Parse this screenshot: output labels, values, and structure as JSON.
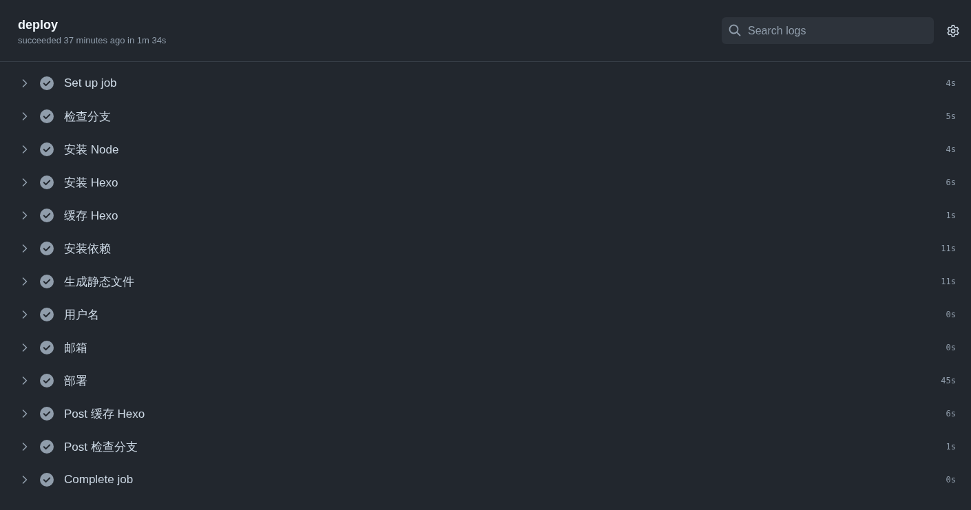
{
  "job": {
    "title": "deploy",
    "summary": "succeeded 37 minutes ago in 1m 34s"
  },
  "search": {
    "placeholder": "Search logs"
  },
  "steps": [
    {
      "name": "Set up job",
      "duration": "4s",
      "kind": "success",
      "expanded": false
    },
    {
      "name": "检查分支",
      "duration": "5s",
      "kind": "success",
      "expanded": false
    },
    {
      "name": "安装 Node",
      "duration": "4s",
      "kind": "success",
      "expanded": false
    },
    {
      "name": "安装 Hexo",
      "duration": "6s",
      "kind": "success",
      "expanded": false
    },
    {
      "name": "缓存 Hexo",
      "duration": "1s",
      "kind": "success",
      "expanded": false
    },
    {
      "name": "安装依赖",
      "duration": "11s",
      "kind": "success",
      "expanded": false
    },
    {
      "name": "生成静态文件",
      "duration": "11s",
      "kind": "success",
      "expanded": false
    },
    {
      "name": "用户名",
      "duration": "0s",
      "kind": "success",
      "expanded": false
    },
    {
      "name": "邮箱",
      "duration": "0s",
      "kind": "success",
      "expanded": false
    },
    {
      "name": "部署",
      "duration": "45s",
      "kind": "success",
      "expanded": false
    },
    {
      "name": "Post 缓存 Hexo",
      "duration": "6s",
      "kind": "success",
      "expanded": false
    },
    {
      "name": "Post 检查分支",
      "duration": "1s",
      "kind": "success",
      "expanded": false
    },
    {
      "name": "Complete job",
      "duration": "0s",
      "kind": "success",
      "expanded": false
    }
  ]
}
